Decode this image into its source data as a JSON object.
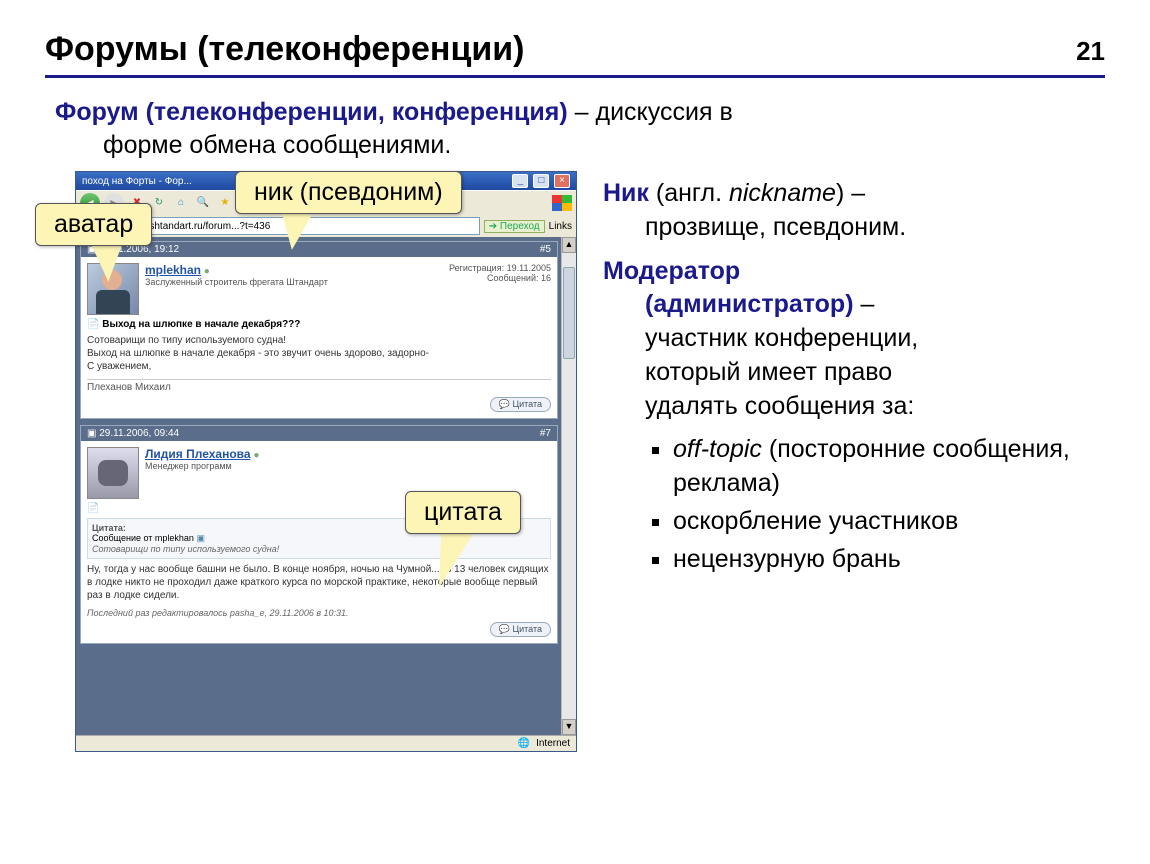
{
  "page_number": "21",
  "title": "Форумы (телеконференции)",
  "intro": {
    "term": "Форум (телеконференции, конференция)",
    "dash": " – ",
    "rest": "дискуссия в",
    "cont": "форме обмена сообщениями."
  },
  "callouts": {
    "avatar": "аватар",
    "nick": "ник (псевдоним)",
    "quote": "цитата"
  },
  "right": {
    "nick_term": "Ник",
    "nick_paren": " (англ. ",
    "nick_em": "nickname",
    "nick_rest": ") –",
    "nick_line2": "прозвище, псевдоним.",
    "mod_term": "Модератор",
    "mod_line2_term": "(администратор)",
    "mod_dash": " –",
    "mod_desc1": "участник конференции,",
    "mod_desc2": "который имеет право",
    "mod_desc3": "удалять сообщения за:",
    "li1_em": "off-topic",
    "li1_rest": " (посторонние сообщения, реклама)",
    "li2": "оскорбление участников",
    "li3": "нецензурную брань"
  },
  "browser": {
    "title": "поход на Форты - Фор...",
    "url": "http://www.shtandart.ru/forum...?t=436",
    "go": "Переход",
    "links": "Links",
    "status": "Internet"
  },
  "posts": [
    {
      "date": "21.11.2006, 19:12",
      "num": "#5",
      "nick": "mplekhan",
      "rank": "Заслуженный строитель фрегата Штандарт",
      "reg_label": "Регистрация:",
      "reg": "19.11.2005",
      "msgs_label": "Сообщений:",
      "msgs": "16",
      "subject": "Выход на шлюпке в начале декабря???",
      "body1": "Сотоварищи по типу используемого судна!",
      "body2": "Выход на шлюпке в начале декабря - это звучит очень здорово, задорно-",
      "body3": "С уважением,",
      "sig": "Плеханов Михаил",
      "quote_btn": "Цитата"
    },
    {
      "date": "29.11.2006, 09:44",
      "num": "#7",
      "nick": "Лидия Плеханова",
      "rank": "Менеджер программ",
      "q_head": "Цитата:",
      "q_from": "Сообщение от mplekhan",
      "q_text": "Сотоварищи по типу используемого судна!",
      "body1": "Ну, тогда у нас вообще башни не было. В конце ноября, ночью на Чумной...Из 13 человек сидящих в лодке никто не проходил даже краткого курса по морской практике, некоторые вообще первый раз в лодке сидели.",
      "edited": "Последний раз редактировалось pasha_e, 29.11.2006 в 10:31.",
      "quote_btn": "Цитата"
    }
  ]
}
